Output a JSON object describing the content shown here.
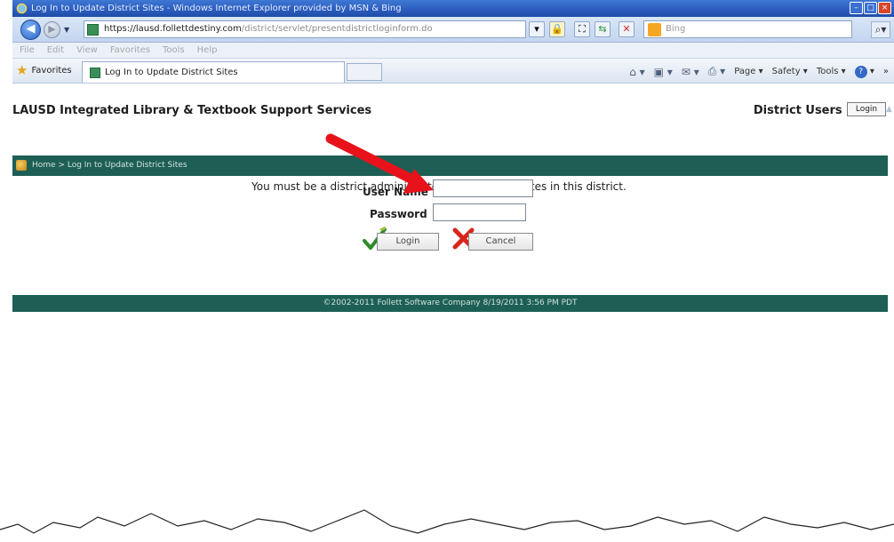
{
  "browser": {
    "window_title": "Log In to Update District Sites - Windows Internet Explorer provided by MSN & Bing",
    "url_host": "https://lausd.follettdestiny.com",
    "url_path": "/district/servlet/presentdistrictloginform.do",
    "search_placeholder": "Bing",
    "menu": [
      "File",
      "Edit",
      "View",
      "Favorites",
      "Tools",
      "Help"
    ],
    "favorites_label": "Favorites",
    "tab_title": "Log In to Update District Sites",
    "command_bar": {
      "page": "Page",
      "safety": "Safety",
      "tools": "Tools"
    },
    "overflow": "»"
  },
  "page": {
    "header_title": "LAUSD Integrated Library & Textbook Support Services",
    "district_users": "District Users ...",
    "login_top": "Login",
    "breadcrumb": "Home > Log In to Update District Sites",
    "message": "You must be a district administrator to update the sites in this district.",
    "username_label": "User Name",
    "password_label": "Password",
    "login_button": "Login",
    "cancel_button": "Cancel",
    "footer": "©2002-2011  Follett Software Company     8/19/2011 3:56 PM PDT"
  },
  "colors": {
    "accent_green": "#1d5f55",
    "arrow_red": "#e8121a"
  }
}
